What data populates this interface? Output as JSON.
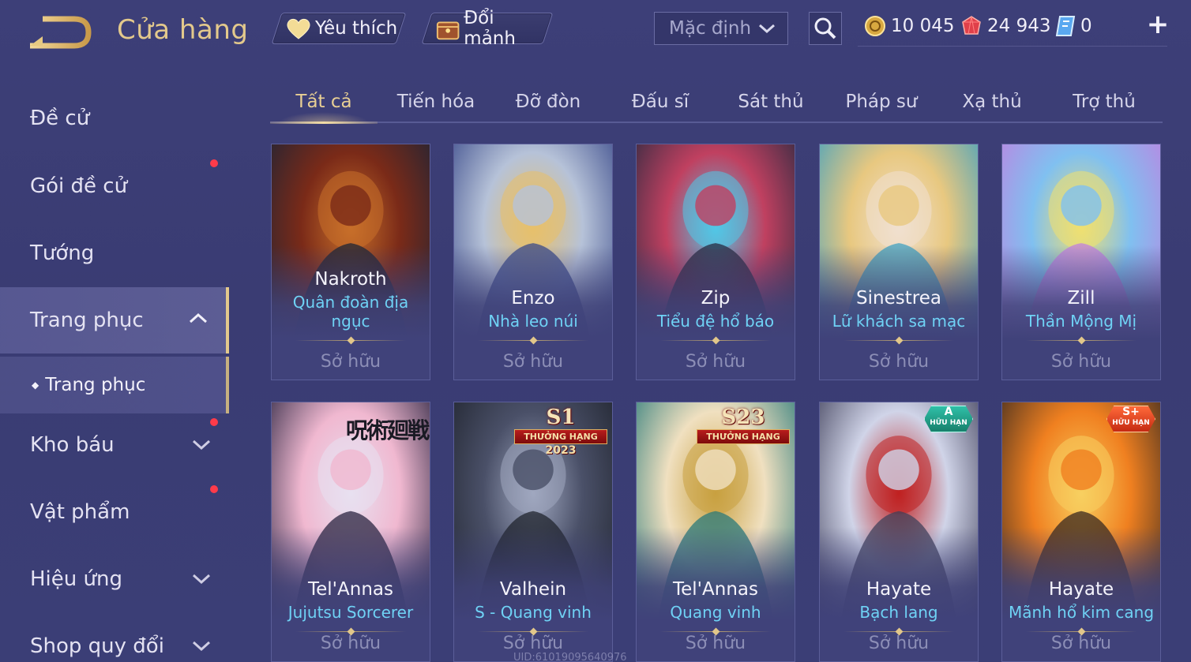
{
  "header": {
    "title": "Cửa hàng",
    "favorites_label": "Yêu thích",
    "exchange_label": "Đổi mảnh",
    "sort_value": "Mặc định",
    "currencies": [
      {
        "icon": "gold-coin-icon",
        "value": "10 045"
      },
      {
        "icon": "ruby-gem-icon",
        "value": "24 943"
      },
      {
        "icon": "voucher-icon",
        "value": "0"
      }
    ]
  },
  "sidebar": {
    "items": [
      {
        "label": "Đề cử"
      },
      {
        "label": "Gói đề cử"
      },
      {
        "label": "Tướng"
      },
      {
        "label": "Trang phục"
      },
      {
        "label": "Kho báu"
      },
      {
        "label": "Vật phẩm"
      },
      {
        "label": "Hiệu ứng"
      },
      {
        "label": "Shop quy đổi"
      }
    ],
    "sub_item": "Trang phục"
  },
  "tabs": [
    "Tất cả",
    "Tiến hóa",
    "Đỡ đòn",
    "Đấu sĩ",
    "Sát thủ",
    "Pháp sư",
    "Xạ thủ",
    "Trợ thủ"
  ],
  "cards": [
    {
      "hero": "Nakroth",
      "skin": "Quân đoàn địa ngục",
      "status": "Sở hữu",
      "palette": [
        "#7a2a18",
        "#1c2436",
        "#c8702a"
      ]
    },
    {
      "hero": "Enzo",
      "skin": "Nhà leo núi",
      "status": "Sở hữu",
      "palette": [
        "#b6c2d8",
        "#3a4a8a",
        "#e8c06a"
      ]
    },
    {
      "hero": "Zip",
      "skin": "Tiểu đệ hổ báo",
      "status": "Sở hữu",
      "palette": [
        "#c04060",
        "#2a2a40",
        "#50c8e8"
      ]
    },
    {
      "hero": "Sinestrea",
      "skin": "Lữ khách sa mạc",
      "status": "Sở hữu",
      "palette": [
        "#e8c880",
        "#40a0c0",
        "#f0e0d0"
      ]
    },
    {
      "hero": "Zill",
      "skin": "Thần Mộng Mị",
      "status": "Sở hữu",
      "palette": [
        "#80c0f0",
        "#c080e0",
        "#f0e070"
      ]
    },
    {
      "hero": "Tel'Annas",
      "skin": "Jujutsu Sorcerer",
      "status": "Sở hữu",
      "palette": [
        "#f0b8d0",
        "#2a2440",
        "#e8e0f0"
      ],
      "logo": "呪術廻戦"
    },
    {
      "hero": "Valhein",
      "skin": "S - Quang vinh",
      "status": "Sở hữu",
      "palette": [
        "#4a5068",
        "#20242e",
        "#a0a8c0"
      ],
      "badge": {
        "type": "rank",
        "main": "S1",
        "ribbon": "THƯỞNG HẠNG",
        "year": "2023"
      }
    },
    {
      "hero": "Tel'Annas",
      "skin": "Quang vinh",
      "status": "Sở hữu",
      "palette": [
        "#f0e0c0",
        "#2a7a7a",
        "#c8a040"
      ],
      "badge": {
        "type": "rank",
        "main": "S23",
        "ribbon": "THƯỞNG HẠNG",
        "year": ""
      }
    },
    {
      "hero": "Hayate",
      "skin": "Bạch lang",
      "status": "Sở hữu",
      "palette": [
        "#d0d4e8",
        "#40405a",
        "#c02020"
      ],
      "badge": {
        "type": "tier",
        "main": "A",
        "sub": "HỮU HẠN",
        "color": "teal"
      }
    },
    {
      "hero": "Hayate",
      "skin": "Mãnh hổ kim cang",
      "status": "Sở hữu",
      "palette": [
        "#f08020",
        "#3a2a20",
        "#f8d060"
      ],
      "badge": {
        "type": "tier",
        "main": "S+",
        "sub": "HỮU HẠN",
        "color": "red"
      }
    }
  ],
  "watermark": "UID:61019095640976",
  "colors": {
    "accent_gold": "#e3c98c",
    "skin_name_blue": "#6fd2f5",
    "notification_red": "#ff3b4a"
  }
}
